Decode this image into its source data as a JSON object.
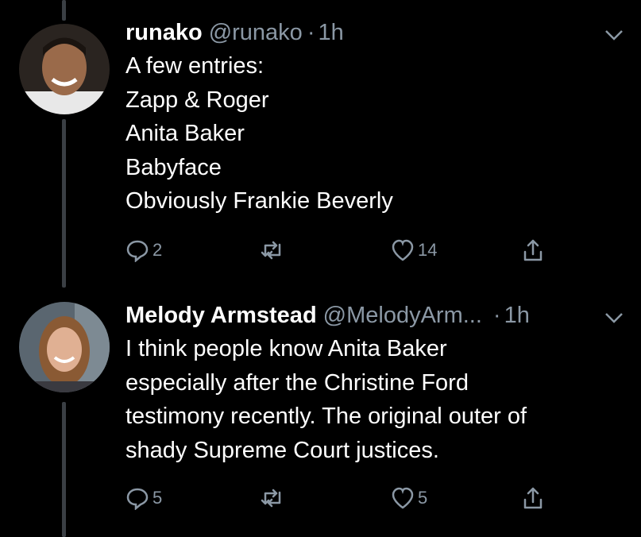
{
  "tweets": [
    {
      "name": "runako",
      "handle": "@runako",
      "separator": "·",
      "time": "1h",
      "lines": [
        "A few entries:",
        "Zapp & Roger",
        "Anita Baker",
        "Babyface",
        "Obviously Frankie Beverly"
      ],
      "replies": "2",
      "retweets": "",
      "likes": "14"
    },
    {
      "name": "Melody Armstead",
      "handle": "@MelodyArm...",
      "separator": "·",
      "time": "1h",
      "lines": [
        "I think people know Anita Baker",
        "especially after the Christine Ford",
        "testimony recently. The original outer of",
        "shady Supreme Court justices."
      ],
      "replies": "5",
      "retweets": "",
      "likes": "5"
    }
  ],
  "colors": {
    "background": "#000000",
    "text": "#ffffff",
    "muted": "#8b98a5",
    "thread_line": "#3a3f44"
  },
  "icons": [
    "reply-icon",
    "retweet-icon",
    "like-icon",
    "share-icon",
    "chevron-down-icon"
  ]
}
